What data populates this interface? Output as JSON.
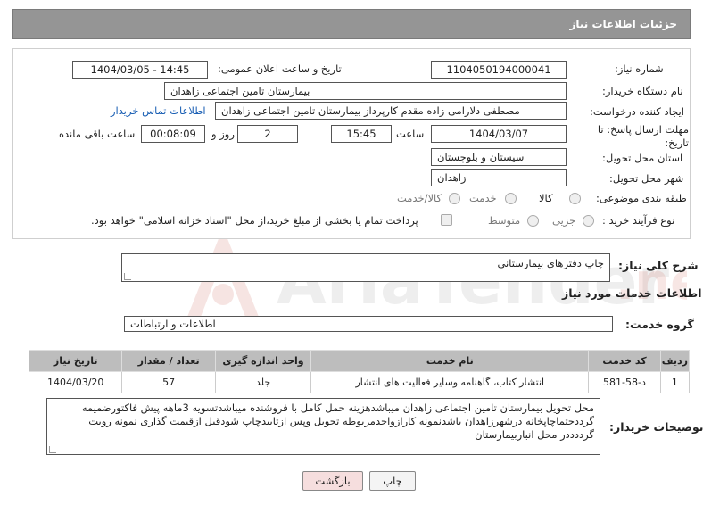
{
  "header": {
    "title": "جزئیات اطلاعات نیاز"
  },
  "form": {
    "need_number_label": "شماره نیاز:",
    "need_number": "1104050194000041",
    "announce_label": "تاریخ و ساعت اعلان عمومی:",
    "announce_value": "1404/03/05 - 14:45",
    "buyer_org_label": "نام دستگاه خریدار:",
    "buyer_org": "بیمارستان تامین اجتماعی زاهدان",
    "creator_label": "ایجاد کننده درخواست:",
    "creator": "مصطفی دلارامی زاده مقدم کارپرداز بیمارستان تامین اجتماعی زاهدان",
    "contact_link": "اطلاعات تماس خریدار",
    "deadline_label": "مهلت ارسال پاسخ: تا تاریخ:",
    "deadline_date": "1404/03/07",
    "hour_label": "ساعت",
    "deadline_hour": "15:45",
    "days_value": "2",
    "days_label": "روز و",
    "remaining_time": "00:08:09",
    "remaining_label": "ساعت باقی مانده",
    "province_label": "استان محل تحویل:",
    "province": "سیستان و بلوچستان",
    "city_label": "شهر محل تحویل:",
    "city": "زاهدان",
    "category_label": "طبقه بندی موضوعی:",
    "category_options": [
      "کالا",
      "خدمت",
      "کالا/خدمت"
    ],
    "purchase_label": "نوع فرآیند خرید :",
    "purchase_options": [
      "جزیی",
      "متوسط"
    ],
    "payment_note": "پرداخت تمام یا بخشی از مبلغ خرید،از محل \"اسناد خزانه اسلامی\" خواهد بود."
  },
  "summary": {
    "label": "شرح کلی نیاز:",
    "value": "چاپ دفترهای بیمارستانی"
  },
  "services": {
    "section_title": "اطلاعات خدمات مورد نیاز",
    "group_label": "گروه خدمت:",
    "group_value": "اطلاعات و ارتباطات",
    "columns": [
      "ردیف",
      "کد خدمت",
      "نام خدمت",
      "واحد اندازه گیری",
      "تعداد / مقدار",
      "تاریخ نیاز"
    ],
    "rows": [
      {
        "row": "1",
        "code": "د-58-581",
        "name": "انتشار کتاب، گاهنامه وسایر فعالیت های انتشار",
        "unit": "جلد",
        "qty": "57",
        "date": "1404/03/20"
      }
    ]
  },
  "buyer_notes": {
    "label": "توضیحات خریدار:",
    "value": "محل تحویل بیمارستان تامین اجتماعی زاهدان میباشدهزینه حمل کامل با فروشنده میباشدتسویه 3ماهه پیش فاکتورضمیمه گرددحتماچاپخانه درشهرزاهدان باشدنمونه کارازواحدمربوطه تحویل وپس ازتاییدچاپ شودقبل ازقیمت گذاری نمونه رویت گرددددر محل انباربیمارستان"
  },
  "buttons": {
    "print": "چاپ",
    "back": "بازگشت"
  },
  "colors": {
    "header_bg": "#959595",
    "table_head": "#bdbdbd",
    "back_btn": "#f6dede",
    "link": "#1a5fb4"
  }
}
